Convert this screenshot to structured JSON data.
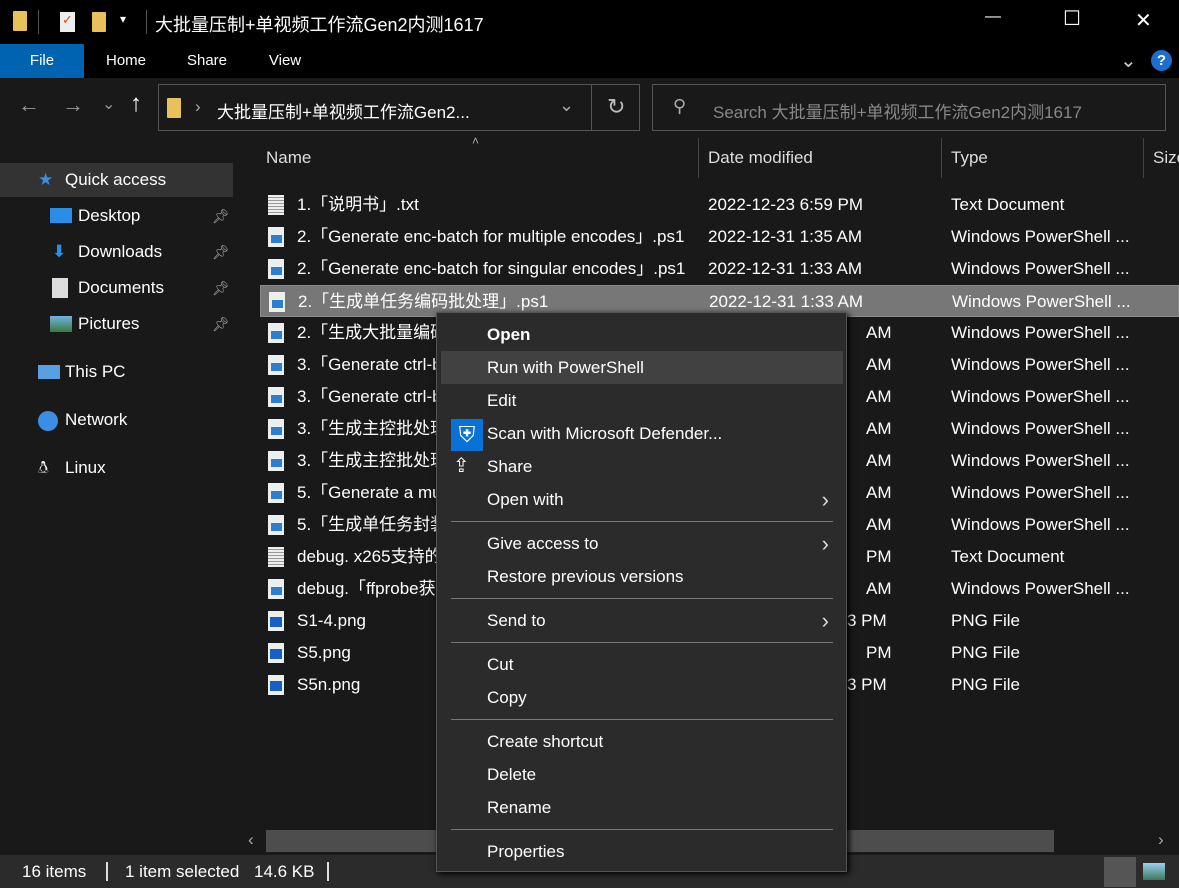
{
  "window": {
    "title": "大批量压制+单视频工作流Gen2内测1617",
    "minimize": "—",
    "maximize": "☐",
    "close": "✕"
  },
  "ribbon": {
    "tabs": [
      "File",
      "Home",
      "Share",
      "View"
    ],
    "help": "?",
    "expand": "⌄"
  },
  "address": {
    "path": "大批量压制+单视频工作流Gen2...",
    "refresh": "↻",
    "back": "←",
    "forward": "→",
    "recent": "⌄",
    "up": "↑",
    "dropdown": "⌄",
    "search_placeholder": "Search 大批量压制+单视频工作流Gen2内测1617"
  },
  "sidebar": {
    "items": [
      {
        "label": "Quick access",
        "icon": "star-icon",
        "pinned": false
      },
      {
        "label": "Desktop",
        "icon": "desktop-icon",
        "pinned": true
      },
      {
        "label": "Downloads",
        "icon": "download-icon",
        "pinned": true
      },
      {
        "label": "Documents",
        "icon": "document-icon",
        "pinned": true
      },
      {
        "label": "Pictures",
        "icon": "pictures-icon",
        "pinned": true
      },
      {
        "label": "This PC",
        "icon": "computer-icon",
        "pinned": false
      },
      {
        "label": "Network",
        "icon": "network-icon",
        "pinned": false
      },
      {
        "label": "Linux",
        "icon": "linux-icon",
        "pinned": false
      }
    ]
  },
  "columns": [
    "Name",
    "Date modified",
    "Type",
    "Size"
  ],
  "files": [
    {
      "name": "1.「说明书」.txt",
      "date": "2022-12-23 6:59 PM",
      "type": "Text Document",
      "icon": "txt"
    },
    {
      "name": "2.「Generate enc-batch for multiple encodes」.ps1",
      "date": "2022-12-31 1:35 AM",
      "type": "Windows PowerShell ...",
      "icon": "ps"
    },
    {
      "name": "2.「Generate enc-batch for singular encodes」.ps1",
      "date": "2022-12-31 1:33 AM",
      "type": "Windows PowerShell ...",
      "icon": "ps"
    },
    {
      "name": "2.「生成单任务编码批处理」.ps1",
      "date": "2022-12-31 1:33 AM",
      "type": "Windows PowerShell ...",
      "icon": "ps",
      "selected": true
    },
    {
      "name": "2.「生成大批量编码",
      "date": "AM",
      "type": "Windows PowerShell ...",
      "icon": "ps"
    },
    {
      "name": "3.「Generate ctrl-b",
      "date": "AM",
      "type": "Windows PowerShell ...",
      "icon": "ps"
    },
    {
      "name": "3.「Generate ctrl-b",
      "date": "AM",
      "type": "Windows PowerShell ...",
      "icon": "ps"
    },
    {
      "name": "3.「生成主控批处理",
      "date": "AM",
      "type": "Windows PowerShell ...",
      "icon": "ps"
    },
    {
      "name": "3.「生成主控批处理",
      "date": "AM",
      "type": "Windows PowerShell ...",
      "icon": "ps"
    },
    {
      "name": "5.「Generate a mu",
      "date": "AM",
      "type": "Windows PowerShell ...",
      "icon": "ps"
    },
    {
      "name": "5.「生成单任务封装",
      "date": "AM",
      "type": "Windows PowerShell ...",
      "icon": "ps"
    },
    {
      "name": "debug. x265支持的",
      "date": "PM",
      "type": "Text Document",
      "icon": "txt"
    },
    {
      "name": "debug.「ffprobe获",
      "date": "AM",
      "type": "Windows PowerShell ...",
      "icon": "ps"
    },
    {
      "name": "S1-4.png",
      "date": "3 PM",
      "type": "PNG File",
      "icon": "png"
    },
    {
      "name": "S5.png",
      "date": "PM",
      "type": "PNG File",
      "icon": "png"
    },
    {
      "name": "S5n.png",
      "date": "3 PM",
      "type": "PNG File",
      "icon": "png"
    }
  ],
  "context_menu": {
    "groups": [
      [
        {
          "label": "Open",
          "bold": true
        },
        {
          "label": "Run with PowerShell",
          "highlighted": true
        },
        {
          "label": "Edit"
        },
        {
          "label": "Scan with Microsoft Defender...",
          "icon": "defender-shield-icon"
        },
        {
          "label": "Share",
          "icon": "share-icon"
        },
        {
          "label": "Open with",
          "submenu": true
        }
      ],
      [
        {
          "label": "Give access to",
          "submenu": true
        },
        {
          "label": "Restore previous versions"
        }
      ],
      [
        {
          "label": "Send to",
          "submenu": true
        }
      ],
      [
        {
          "label": "Cut"
        },
        {
          "label": "Copy"
        }
      ],
      [
        {
          "label": "Create shortcut"
        },
        {
          "label": "Delete"
        },
        {
          "label": "Rename"
        }
      ],
      [
        {
          "label": "Properties"
        }
      ]
    ]
  },
  "status": {
    "count": "16 items",
    "selection": "1 item selected",
    "size": "14.6 KB"
  },
  "colors": {
    "accent": "#0063b1",
    "selected_row": "#777777",
    "menu_bg": "#2b2b2b"
  }
}
